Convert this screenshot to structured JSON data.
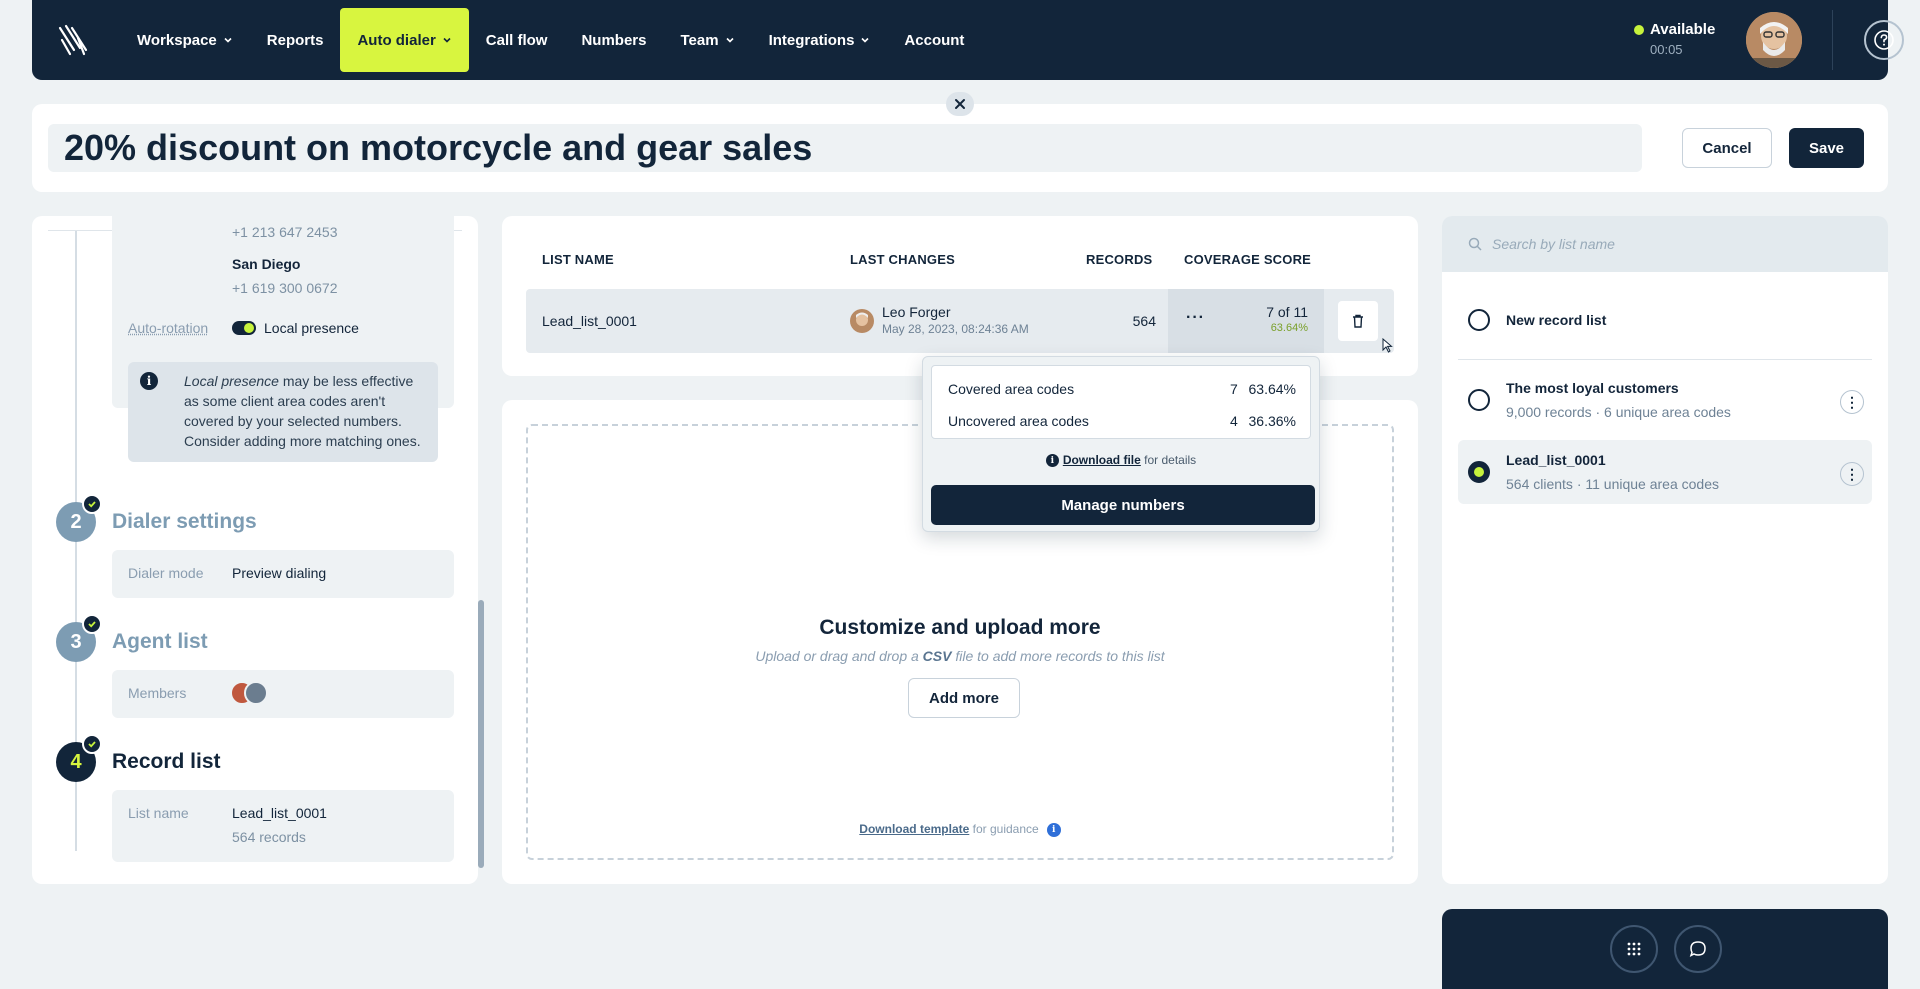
{
  "nav": {
    "items": [
      {
        "label": "Workspace",
        "dropdown": true,
        "active": false
      },
      {
        "label": "Reports",
        "dropdown": false,
        "active": false
      },
      {
        "label": "Auto dialer",
        "dropdown": true,
        "active": true
      },
      {
        "label": "Call flow",
        "dropdown": false,
        "active": false
      },
      {
        "label": "Numbers",
        "dropdown": false,
        "active": false
      },
      {
        "label": "Team",
        "dropdown": true,
        "active": false
      },
      {
        "label": "Integrations",
        "dropdown": true,
        "active": false
      },
      {
        "label": "Account",
        "dropdown": false,
        "active": false
      }
    ],
    "status_label": "Available",
    "status_time": "00:05",
    "accent": "#d8f53f",
    "status_color": "#c7f33c"
  },
  "header": {
    "title": "20% discount on motorcycle and gear sales",
    "cancel_label": "Cancel",
    "save_label": "Save"
  },
  "left": {
    "number_cut": "+1 213 647 2453",
    "city": "San Diego",
    "city_number": "+1 619 300 0672",
    "auto_rotation_label": "Auto-rotation",
    "local_presence_label": "Local presence",
    "note_em": "Local presence",
    "note_rest": "may be less effective as some client area codes aren't covered by your selected numbers. Consider adding more matching ones.",
    "steps": [
      {
        "num": "2",
        "title": "Dialer settings",
        "field_label": "Dialer mode",
        "field_value": "Preview dialing"
      },
      {
        "num": "3",
        "title": "Agent list",
        "field_label": "Members"
      },
      {
        "num": "4",
        "title": "Record list",
        "field_label": "List name",
        "field_value": "Lead_list_0001",
        "field_sub": "564 records"
      }
    ]
  },
  "table": {
    "headers": [
      "LIST NAME",
      "LAST CHANGES",
      "RECORDS",
      "COVERAGE SCORE"
    ],
    "row": {
      "name": "Lead_list_0001",
      "user": "Leo Forger",
      "date": "May 28, 2023, 08:24:36 AM",
      "records": "564",
      "more": "···",
      "score": "7 of 11",
      "score_pct": "63.64%"
    }
  },
  "popover": {
    "covered_label": "Covered area codes",
    "covered_n": "7",
    "covered_pct": "63.64%",
    "uncovered_label": "Uncovered area codes",
    "uncovered_n": "4",
    "uncovered_pct": "36.36%",
    "download_link": "Download file",
    "download_rest": "for details",
    "manage_label": "Manage numbers"
  },
  "upload": {
    "title": "Customize and upload more",
    "sub_pre": "Upload or drag and drop a",
    "sub_bold": "CSV",
    "sub_post": "file to add more records to this list",
    "add_label": "Add more",
    "template_link": "Download template",
    "template_rest": "for guidance"
  },
  "right": {
    "search_placeholder": "Search by list name",
    "lists": [
      {
        "title": "New record list",
        "sub": "",
        "selected": false
      },
      {
        "title": "The most loyal customers",
        "sub": "9,000 records · 6 unique area codes",
        "selected": false
      },
      {
        "title": "Lead_list_0001",
        "sub": "564 clients · 11 unique area codes",
        "selected": true
      }
    ]
  },
  "icons": {
    "logo": "logo-icon",
    "help": "help-icon",
    "close": "close-icon",
    "trash": "trash-icon",
    "search": "search-icon",
    "dialpad": "dialpad-icon",
    "chat": "chat-icon"
  }
}
